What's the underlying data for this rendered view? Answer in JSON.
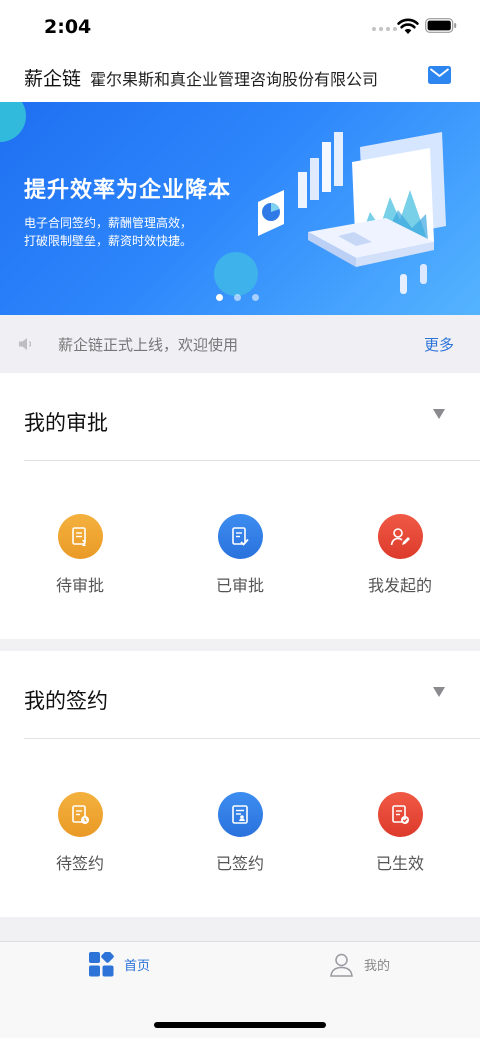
{
  "status_bar": {
    "time": "2:04"
  },
  "header": {
    "brand": "薪企链",
    "company": "霍尔果斯和真企业管理咨询股份有限公司",
    "mail_icon": "envelope-icon"
  },
  "banner": {
    "title": "提升效率为企业降本",
    "subtitle_line1": "电子合同签约，薪酬管理高效，",
    "subtitle_line2": "打破限制壁垒，薪资时效快捷。",
    "slide_count": 3,
    "active_slide": 1
  },
  "notice": {
    "text": "薪企链正式上线，欢迎使用",
    "more_label": "更多"
  },
  "approval": {
    "title": "我的审批",
    "actions": [
      {
        "label": "待审批",
        "icon": "pending-approval-icon",
        "color": "#ee9f2a"
      },
      {
        "label": "已审批",
        "icon": "approved-icon",
        "color": "#2f7ae6"
      },
      {
        "label": "我发起的",
        "icon": "initiated-by-me-icon",
        "color": "#e64733"
      }
    ]
  },
  "signing": {
    "title": "我的签约",
    "actions": [
      {
        "label": "待签约",
        "icon": "pending-sign-icon",
        "color": "#ee9f2a"
      },
      {
        "label": "已签约",
        "icon": "signed-icon",
        "color": "#2f7ae6"
      },
      {
        "label": "已生效",
        "icon": "effective-icon",
        "color": "#e64733"
      }
    ]
  },
  "tab_bar": {
    "tabs": [
      {
        "label": "首页",
        "icon": "home-grid-icon",
        "active": true
      },
      {
        "label": "我的",
        "icon": "person-icon",
        "active": false
      }
    ],
    "accent_color": "#2d73d8"
  }
}
